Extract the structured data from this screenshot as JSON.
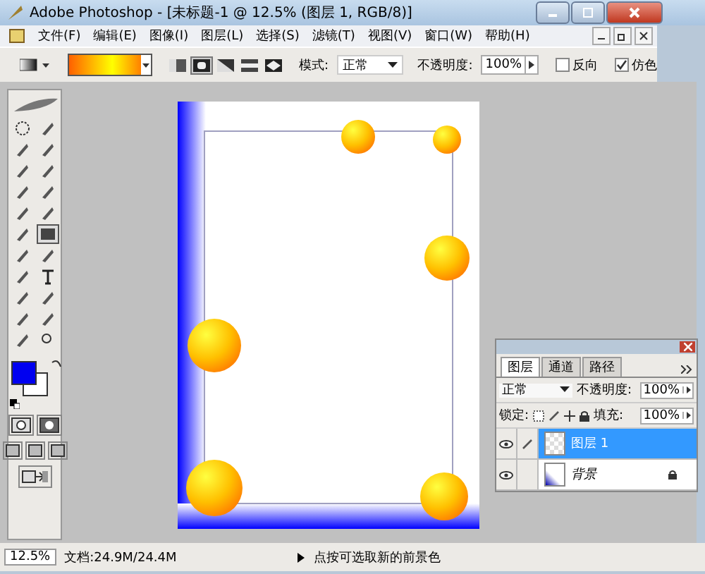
{
  "window": {
    "title": "Adobe Photoshop - [未标题-1 @ 12.5% (图层 1, RGB/8)]"
  },
  "menu": [
    "文件(F)",
    "编辑(E)",
    "图像(I)",
    "图层(L)",
    "选择(S)",
    "滤镜(T)",
    "视图(V)",
    "窗口(W)",
    "帮助(H)"
  ],
  "options": {
    "gradient_types": [
      {
        "selected": false
      },
      {
        "selected": true
      },
      {
        "selected": false
      },
      {
        "selected": false
      },
      {
        "selected": false
      }
    ],
    "mode_label": "模式:",
    "mode": "正常",
    "opacity_label": "不透明度:",
    "opacity": "100%",
    "checks": [
      {
        "label": "反向",
        "checked": false
      },
      {
        "label": "仿色",
        "checked": true
      }
    ]
  },
  "layers_panel": {
    "tabs": [
      {
        "label": "图层",
        "selected": true
      },
      {
        "label": "通道",
        "selected": false
      },
      {
        "label": "路径",
        "selected": false
      }
    ],
    "blend": "正常",
    "opacity_label": "不透明度:",
    "opacity": "100%",
    "lock_label": "锁定:",
    "fill_label": "填充:",
    "fill": "100%",
    "layers": [
      {
        "name": "图层 1",
        "selected": true,
        "locked": false,
        "italic": false
      },
      {
        "name": "背景",
        "selected": false,
        "locked": true,
        "italic": true
      }
    ]
  },
  "status_bar": {
    "zoom": "12.5%",
    "doc": "文档:24.9M/24.4M",
    "hint": "点按可选取新的前景色"
  }
}
